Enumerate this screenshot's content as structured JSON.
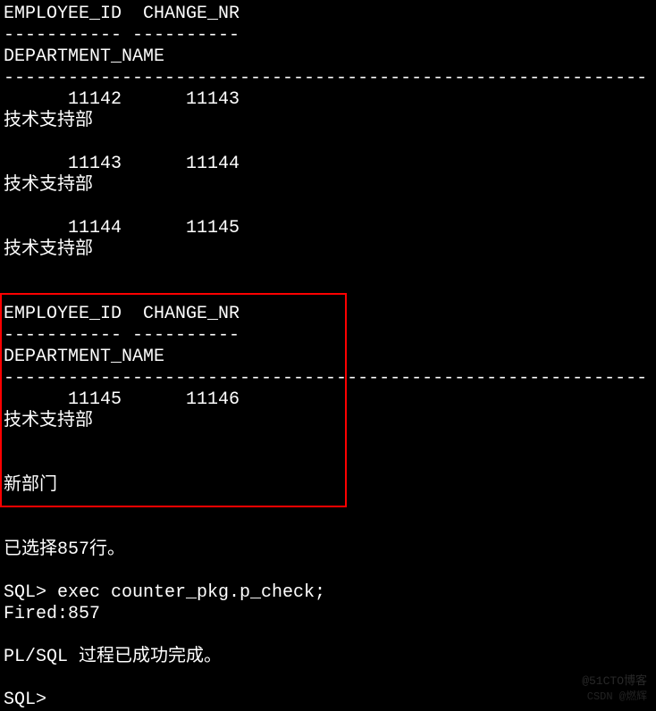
{
  "header1": {
    "cols": "EMPLOYEE_ID  CHANGE_NR",
    "sep1": "----------- ----------",
    "dept": "DEPARTMENT_NAME",
    "sep2": "------------------------------------------------------------"
  },
  "rows1": [
    {
      "vals": "      11142      11143",
      "dept": "技术支持部"
    },
    {
      "vals": "      11143      11144",
      "dept": "技术支持部"
    },
    {
      "vals": "      11144      11145",
      "dept": "技术支持部"
    }
  ],
  "header2": {
    "cols": "EMPLOYEE_ID  CHANGE_NR",
    "sep1": "----------- ----------",
    "dept": "DEPARTMENT_NAME",
    "sep2": "------------------------------------------------------------"
  },
  "rows2": [
    {
      "vals": "      11145      11146",
      "dept": "技术支持部"
    }
  ],
  "new_dept": "新部门",
  "selected": "已选择857行。",
  "sql_cmd": "SQL> exec counter_pkg.p_check;",
  "fired": "Fired:857",
  "plsql_done": "PL/SQL 过程已成功完成。",
  "sql_prompt": "SQL>",
  "watermark1": "@51CTO博客",
  "watermark2": "CSDN @燃辉"
}
